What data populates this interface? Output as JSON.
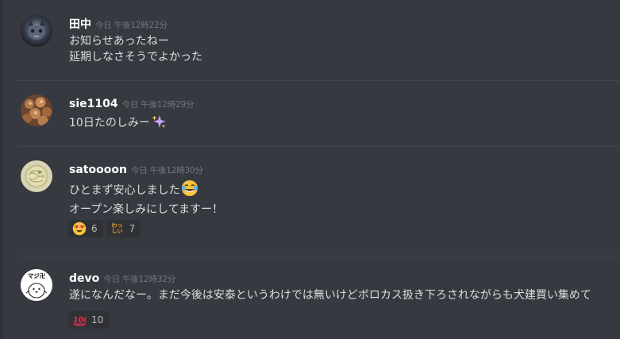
{
  "messages": [
    {
      "username": "田中",
      "timestamp": "今日 午後12時22分",
      "lines": [
        "お知らせあったねー",
        "延期しなさそうでよかった"
      ],
      "avatar": "dark-cat-avatar"
    },
    {
      "username": "sie1104",
      "timestamp": "今日 午後12時29分",
      "lines": [
        "10日たのしみー"
      ],
      "trailing_emoji": "sparkles-icon",
      "avatar": "food-photo-avatar"
    },
    {
      "username": "satoooon",
      "timestamp": "今日 午後12時30分",
      "lines": [
        "ひとまず安心しました",
        "オープン楽しみにしてますー！"
      ],
      "trailing_emoji": "joy-icon",
      "avatar": "noodle-photo-avatar",
      "reactions": [
        {
          "icon": "heart-eyes-icon",
          "count": "6"
        },
        {
          "icon": "wakuwaku-sticker-icon",
          "icon_text": "わっ\nしい",
          "count": "7"
        }
      ]
    },
    {
      "username": "devo",
      "timestamp": "今日 午後12時32分",
      "lines": [
        "遂になんだなー。まだ今後は安泰というわけでは無いけどボロカス扱き下ろされながらも犬建買い集めて"
      ],
      "avatar": "majiso-bird-avatar",
      "avatar_text": "マジ卍",
      "reactions": [
        {
          "icon": "hundred-icon",
          "count": "10"
        }
      ]
    }
  ],
  "colors": {
    "background": "#36393f",
    "username": "#ffffff",
    "text": "#dcddde",
    "timestamp": "#72767d",
    "reaction_bg": "#2f3136"
  }
}
